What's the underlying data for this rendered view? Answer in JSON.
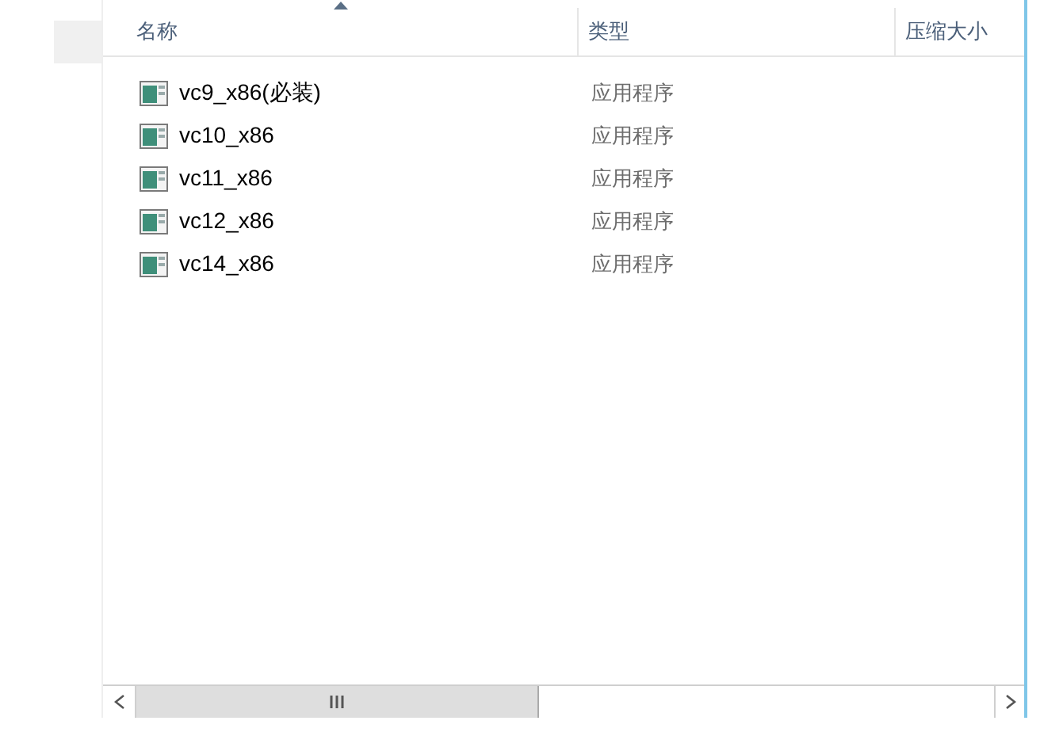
{
  "columns": [
    {
      "label": "名称",
      "sorted": true
    },
    {
      "label": "类型",
      "sorted": false
    },
    {
      "label": "压缩大小",
      "sorted": false
    }
  ],
  "rows": [
    {
      "name": "vc9_x86(必装)",
      "type": "应用程序"
    },
    {
      "name": "vc10_x86",
      "type": "应用程序"
    },
    {
      "name": "vc11_x86",
      "type": "应用程序"
    },
    {
      "name": "vc12_x86",
      "type": "应用程序"
    },
    {
      "name": "vc14_x86",
      "type": "应用程序"
    }
  ]
}
